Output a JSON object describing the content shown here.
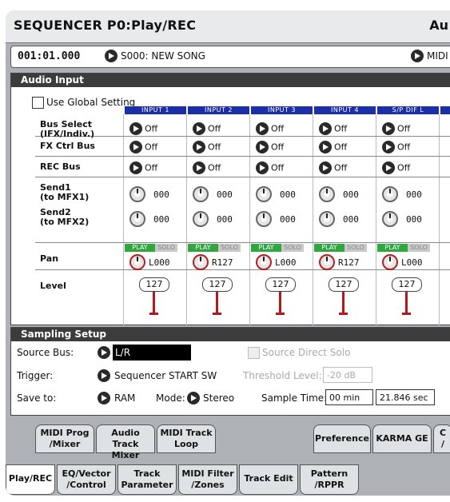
{
  "header": {
    "title": "SEQUENCER P0:Play/REC",
    "title_right": "Au"
  },
  "songbar": {
    "location": "001:01.000",
    "song": "S000: NEW SONG",
    "midi": "MIDI"
  },
  "audio_input": {
    "title": "Audio Input",
    "use_global": "Use Global Setting",
    "channels": [
      "INPUT 1",
      "INPUT 2",
      "INPUT 3",
      "INPUT 4",
      "S/P DIF L"
    ],
    "rows": {
      "bus_select": {
        "label_1": "Bus Select",
        "label_2": "(IFX/Indiv.)",
        "values": [
          "Off",
          "Off",
          "Off",
          "Off",
          "Off"
        ]
      },
      "fx_ctrl": {
        "label": "FX Ctrl Bus",
        "values": [
          "Off",
          "Off",
          "Off",
          "Off",
          "Off"
        ]
      },
      "rec_bus": {
        "label": "REC Bus",
        "values": [
          "Off",
          "Off",
          "Off",
          "Off",
          "Off"
        ]
      },
      "send1": {
        "label_1": "Send1",
        "label_2": "(to MFX1)",
        "values": [
          "000",
          "000",
          "000",
          "000",
          "000"
        ]
      },
      "send2": {
        "label_1": "Send2",
        "label_2": "(to MFX2)",
        "values": [
          "000",
          "000",
          "000",
          "000",
          "000"
        ]
      },
      "pan": {
        "label": "Pan",
        "values": [
          "L000",
          "R127",
          "L000",
          "R127",
          "L000"
        ]
      },
      "level": {
        "label": "Level",
        "values": [
          "127",
          "127",
          "127",
          "127",
          "127"
        ]
      }
    },
    "play": "PLAY",
    "solo": "SOLO"
  },
  "sampling": {
    "title": "Sampling Setup",
    "source_bus_label": "Source Bus:",
    "source_bus_value": "L/R",
    "source_direct_solo": "Source Direct Solo",
    "trigger_label": "Trigger:",
    "trigger_value": "Sequencer START SW",
    "threshold_label": "Threshold Level:",
    "threshold_value": "-20 dB",
    "save_to_label": "Save to:",
    "save_to_value": "RAM",
    "mode_label": "Mode:",
    "mode_value": "Stereo",
    "sample_time_label": "Sample Time:",
    "sample_min": "00 min",
    "sample_sec": "21.846 sec"
  },
  "top_tabs": [
    {
      "l1": "MIDI Prog",
      "l2": "/Mixer"
    },
    {
      "l1": "Audio Track",
      "l2": "Mixer"
    },
    {
      "l1": "MIDI Track",
      "l2": "Loop"
    },
    {
      "l1": "Preference",
      "l2": ""
    },
    {
      "l1": "KARMA GE",
      "l2": ""
    },
    {
      "l1": "C",
      "l2": "/"
    }
  ],
  "bottom_tabs": [
    {
      "l1": "Play/REC",
      "l2": ""
    },
    {
      "l1": "EQ/Vector",
      "l2": "/Control"
    },
    {
      "l1": "Track",
      "l2": "Parameter"
    },
    {
      "l1": "MIDI Filter",
      "l2": "/Zones"
    },
    {
      "l1": "Track Edit",
      "l2": ""
    },
    {
      "l1": "Pattern",
      "l2": "/RPPR"
    }
  ]
}
